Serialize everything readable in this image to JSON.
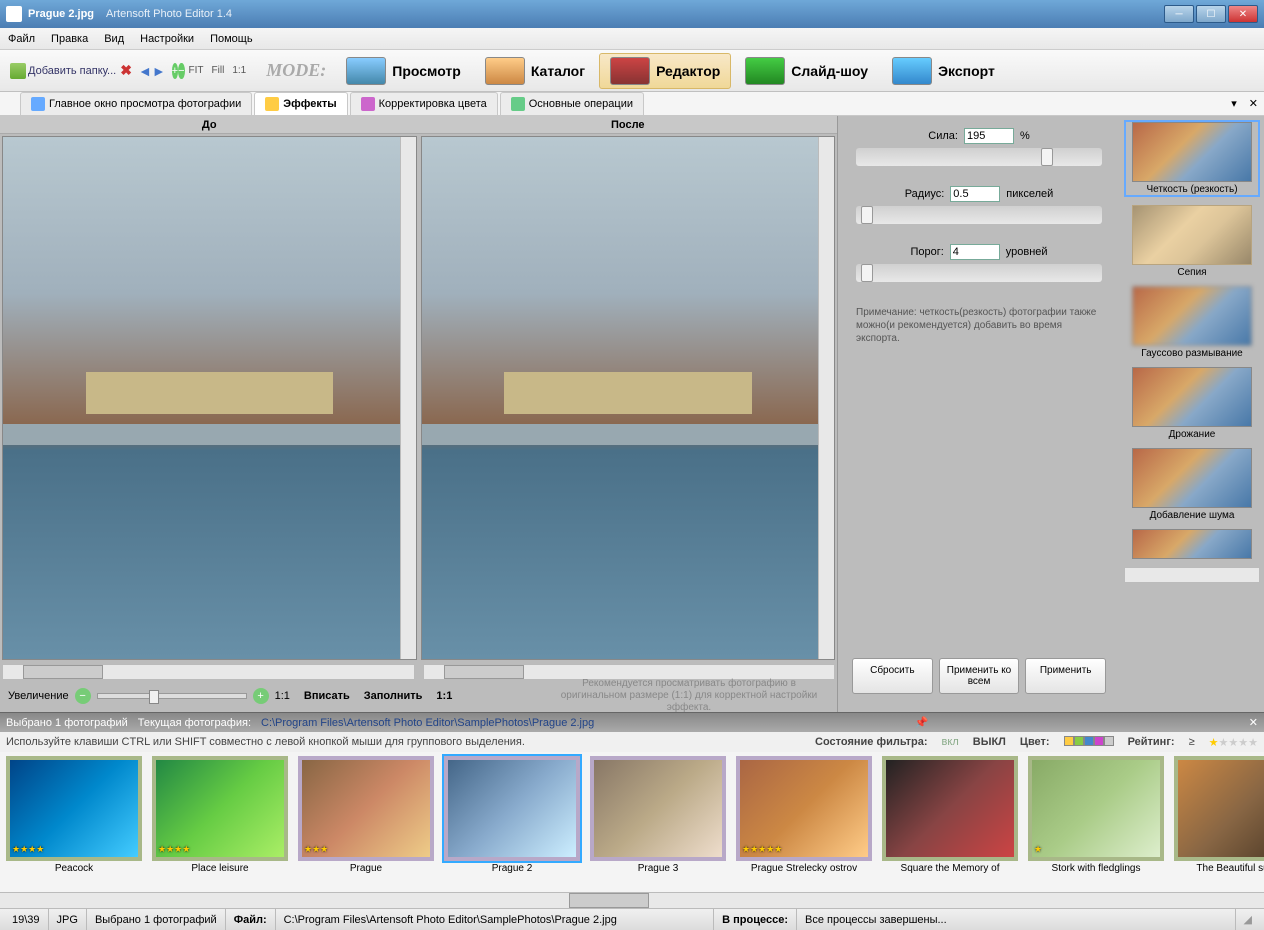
{
  "title": {
    "file": "Prague 2.jpg",
    "app": "Artensoft Photo Editor 1.4"
  },
  "menu": [
    "Файл",
    "Правка",
    "Вид",
    "Настройки",
    "Помощь"
  ],
  "toolbar": {
    "add_folder": "Добавить папку...",
    "fit": "FIT",
    "fill": "Fill",
    "one_one": "1:1",
    "mode_label": "MODE:"
  },
  "modes": [
    {
      "label": "Просмотр",
      "active": false
    },
    {
      "label": "Каталог",
      "active": false
    },
    {
      "label": "Редактор",
      "active": true
    },
    {
      "label": "Слайд-шоу",
      "active": false
    },
    {
      "label": "Экспорт",
      "active": false
    }
  ],
  "tabs": [
    {
      "label": "Главное окно просмотра фотографии",
      "active": false
    },
    {
      "label": "Эффекты",
      "active": true
    },
    {
      "label": "Корректировка цвета",
      "active": false
    },
    {
      "label": "Основные операции",
      "active": false
    }
  ],
  "preview": {
    "before": "До",
    "after": "После"
  },
  "zoom": {
    "label": "Увеличение",
    "one_one": "1:1",
    "fit": "Вписать",
    "fill": "Заполнить",
    "one_one2": "1:1",
    "hint": "Рекомендуется просматривать фотографию в оригинальном размере (1:1) для корректной настройки эффекта."
  },
  "params": {
    "strength_label": "Сила:",
    "strength_val": "195",
    "strength_unit": "%",
    "radius_label": "Радиус:",
    "radius_val": "0.5",
    "radius_unit": "пикселей",
    "threshold_label": "Порог:",
    "threshold_val": "4",
    "threshold_unit": "уровней",
    "note": "Примечание: четкость(резкость) фотографии также можно(и рекомендуется) добавить во время экспорта.",
    "reset": "Сбросить",
    "apply_all": "Применить ко всем",
    "apply": "Применить"
  },
  "effects": [
    "Четкость (резкость)",
    "Сепия",
    "Гауссово размывание",
    "Дрожание",
    "Добавление шума"
  ],
  "filmstrip_header": {
    "selected": "Выбрано 1   фотографий",
    "current_label": "Текущая фотография:",
    "current_path": "C:\\Program Files\\Artensoft Photo Editor\\SamplePhotos\\Prague 2.jpg"
  },
  "filmstrip_sub": {
    "hint": "Используйте клавиши CTRL или SHIFT совместно с левой кнопкой мыши для группового выделения.",
    "filter_label": "Состояние фильтра:",
    "filter_on": "вкл",
    "filter_off": "ВЫКЛ",
    "color_label": "Цвет:",
    "rating_label": "Рейтинг:",
    "rating_op": "≥"
  },
  "film_items": [
    {
      "caption": "Peacock",
      "stars": 4
    },
    {
      "caption": "Place leisure",
      "stars": 4
    },
    {
      "caption": "Prague",
      "stars": 3,
      "sel": true
    },
    {
      "caption": "Prague 2",
      "stars": 0,
      "sel": true,
      "current": true
    },
    {
      "caption": "Prague 3",
      "stars": 0,
      "sel": true
    },
    {
      "caption": "Prague Strelecky ostrov",
      "stars": 5,
      "sel": true
    },
    {
      "caption": "Square the Memory of",
      "stars": 0
    },
    {
      "caption": "Stork with fledglings",
      "stars": 1
    },
    {
      "caption": "The Beautiful sunset",
      "stars": 0
    }
  ],
  "status": {
    "counter": "19\\39",
    "format": "JPG",
    "selected": "Выбрано 1 фотографий",
    "file_label": "Файл:",
    "file_path": "C:\\Program Files\\Artensoft Photo Editor\\SamplePhotos\\Prague 2.jpg",
    "process_label": "В процессе:",
    "process_msg": "Все процессы завершены..."
  },
  "colors": {
    "accent": "#4b7db3"
  }
}
